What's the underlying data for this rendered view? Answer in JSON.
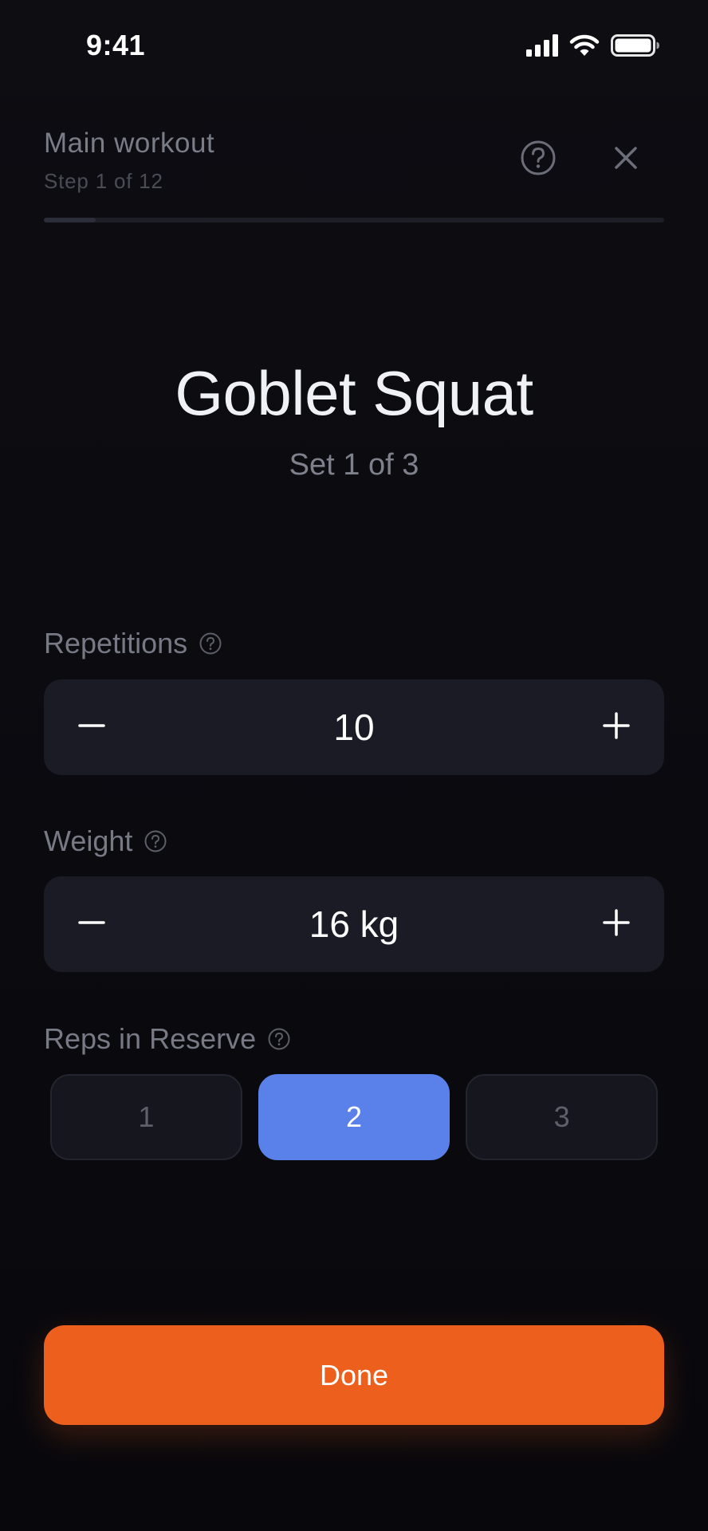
{
  "status_bar": {
    "time": "9:41",
    "icons": [
      "signal-icon",
      "wifi-icon",
      "battery-icon"
    ]
  },
  "header": {
    "title": "Main workout",
    "subtitle": "Step 1 of 12",
    "help_icon": "question-circle-icon",
    "close_icon": "close-icon"
  },
  "progress": {
    "current_step": 1,
    "total_steps": 12
  },
  "exercise": {
    "name": "Goblet Squat",
    "set_label": "Set 1 of 3"
  },
  "fields": {
    "repetitions": {
      "label": "Repetitions",
      "value": "10",
      "decrement_icon": "minus-icon",
      "increment_icon": "plus-icon"
    },
    "weight": {
      "label": "Weight",
      "value": "16 kg",
      "decrement_icon": "minus-icon",
      "increment_icon": "plus-icon"
    },
    "rir": {
      "label": "Reps in Reserve",
      "options": [
        "1",
        "2",
        "3"
      ],
      "selected": "2"
    }
  },
  "done_button": {
    "label": "Done"
  },
  "colors": {
    "background": "#0b0b10",
    "accent_blue": "#5a80ea",
    "accent_orange": "#ec5f1c",
    "card": "#1a1b24"
  }
}
